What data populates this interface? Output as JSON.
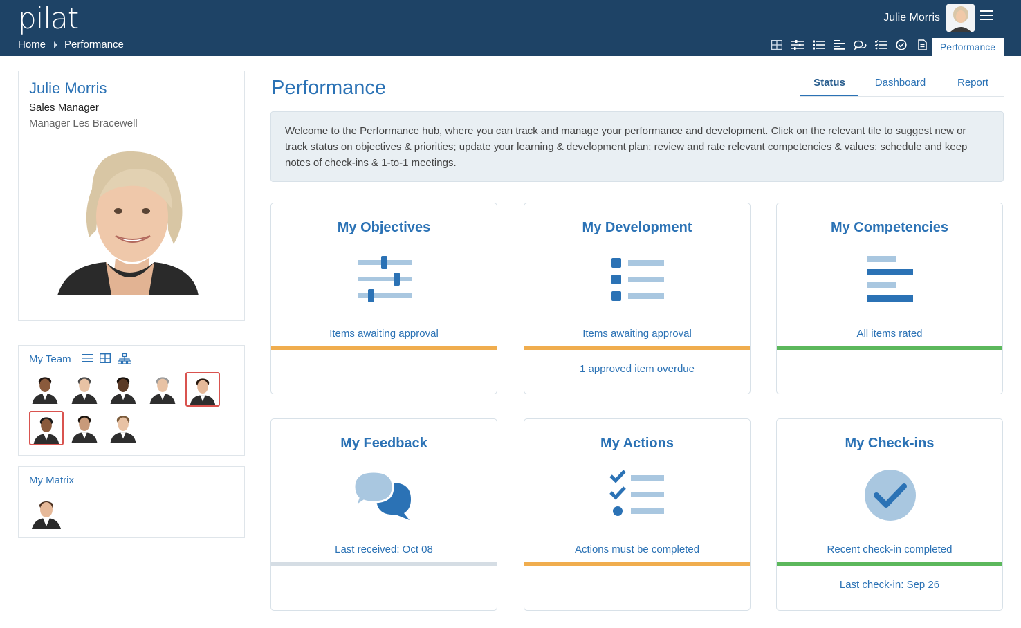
{
  "app": {
    "logo": "pilat"
  },
  "breadcrumb": [
    "Home",
    "Performance"
  ],
  "user": {
    "name": "Julie Morris"
  },
  "nav": {
    "icons": [
      "grid-icon",
      "sliders-icon",
      "list-icon",
      "align-icon",
      "chat-icon",
      "checklist-icon",
      "check-circle-icon",
      "document-icon"
    ],
    "active_tab": "Performance"
  },
  "profile": {
    "name": "Julie Morris",
    "title": "Sales Manager",
    "manager": "Manager Les Bracewell"
  },
  "team": {
    "label": "My Team",
    "view_icons": [
      "list-view-icon",
      "grid-view-icon",
      "org-chart-icon"
    ],
    "members": [
      {
        "flag": false
      },
      {
        "flag": false
      },
      {
        "flag": false
      },
      {
        "flag": false
      },
      {
        "flag": true
      },
      {
        "flag": true
      },
      {
        "flag": false
      },
      {
        "flag": false
      }
    ]
  },
  "matrix": {
    "label": "My Matrix"
  },
  "page": {
    "title": "Performance",
    "tabs": [
      "Status",
      "Dashboard",
      "Report"
    ],
    "active_tab": "Status",
    "welcome": "Welcome to the Performance hub, where you can track and manage your performance and development. Click on the relevant tile to suggest new or track status on objectives & priorities; update your learning & development plan; review and rate relevant competencies & values; schedule and keep notes of check-ins & 1-to-1 meetings."
  },
  "colors": {
    "orange": "#f0ad4e",
    "green": "#5cb85c",
    "grey": "#d5dde4",
    "accent": "#2b72b5",
    "header": "#1e4366"
  },
  "tiles": [
    {
      "title": "My Objectives",
      "icon": "sliders-icon",
      "status": "Items awaiting approval",
      "bar": "orange",
      "sub": ""
    },
    {
      "title": "My Development",
      "icon": "list-icon",
      "status": "Items awaiting approval",
      "bar": "orange",
      "sub": "1 approved item overdue"
    },
    {
      "title": "My Competencies",
      "icon": "align-icon",
      "status": "All items rated",
      "bar": "green",
      "sub": ""
    },
    {
      "title": "My Feedback",
      "icon": "chat-icon",
      "status": "Last received: Oct 08",
      "bar": "grey",
      "sub": ""
    },
    {
      "title": "My Actions",
      "icon": "checklist-icon",
      "status": "Actions must be completed",
      "bar": "orange",
      "sub": ""
    },
    {
      "title": "My Check-ins",
      "icon": "check-circle-icon",
      "status": "Recent check-in completed",
      "bar": "green",
      "sub": "Last check-in: Sep 26"
    }
  ]
}
